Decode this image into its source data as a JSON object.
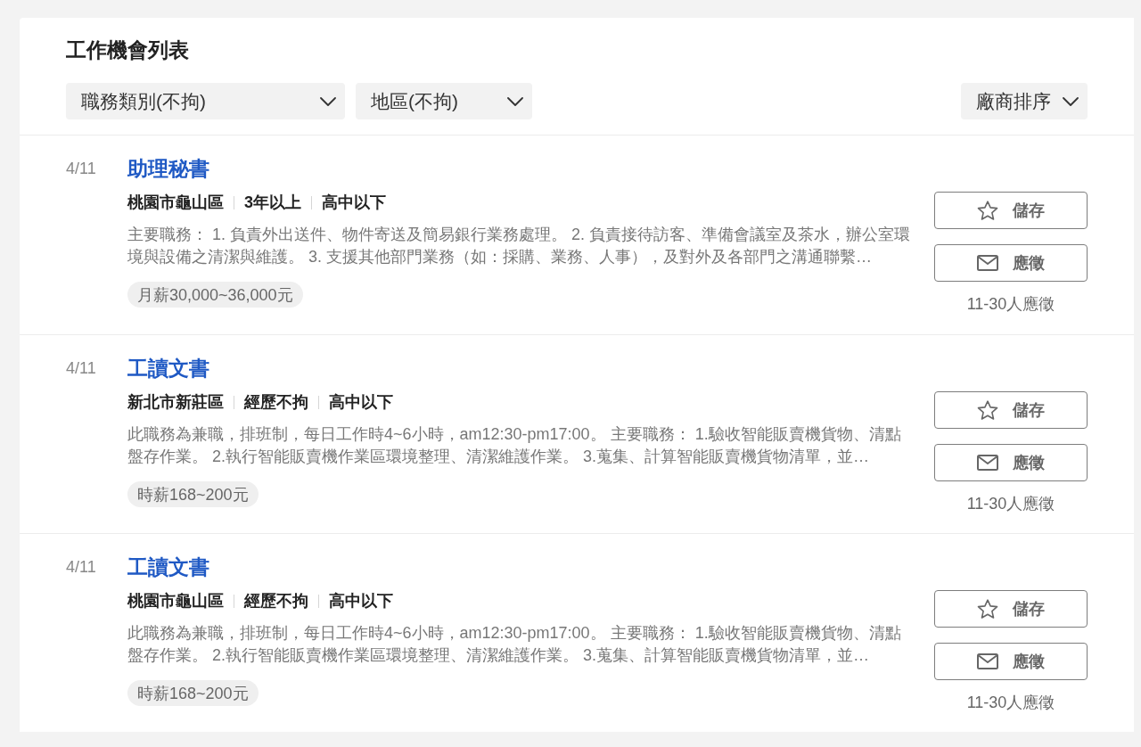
{
  "title": "工作機會列表",
  "filters": [
    {
      "label": "職務類別(不拘)"
    },
    {
      "label": "地區(不拘)"
    }
  ],
  "sort": {
    "label": "廠商排序"
  },
  "jobs": [
    {
      "date": "4/11",
      "title": "助理秘書",
      "meta": [
        "桃園市龜山區",
        "3年以上",
        "高中以下"
      ],
      "description": "主要職務： 1. 負責外出送件、物件寄送及簡易銀行業務處理。 2. 負責接待訪客、準備會議室及茶水，辦公室環境與設備之清潔與維護。 3. 支援其他部門業務（如：採購、業務、人事），及對外及各部門之溝通聯繫…",
      "salary": "月薪30,000~36,000元",
      "save_label": "儲存",
      "apply_label": "應徵",
      "applicants": "11-30人應徵"
    },
    {
      "date": "4/11",
      "title": "工讀文書",
      "meta": [
        "新北市新莊區",
        "經歷不拘",
        "高中以下"
      ],
      "description": "此職務為兼職，排班制，每日工作時4~6小時，am12:30-pm17:00。 主要職務： 1.驗收智能販賣機貨物、清點盤存作業。 2.執行智能販賣機作業區環境整理、清潔維護作業。 3.蒐集、計算智能販賣機貨物清單，並…",
      "salary": "時薪168~200元",
      "save_label": "儲存",
      "apply_label": "應徵",
      "applicants": "11-30人應徵"
    },
    {
      "date": "4/11",
      "title": "工讀文書",
      "meta": [
        "桃園市龜山區",
        "經歷不拘",
        "高中以下"
      ],
      "description": "此職務為兼職，排班制，每日工作時4~6小時，am12:30-pm17:00。 主要職務： 1.驗收智能販賣機貨物、清點盤存作業。 2.執行智能販賣機作業區環境整理、清潔維護作業。 3.蒐集、計算智能販賣機貨物清單，並…",
      "salary": "時薪168~200元",
      "save_label": "儲存",
      "apply_label": "應徵",
      "applicants": "11-30人應徵"
    }
  ]
}
